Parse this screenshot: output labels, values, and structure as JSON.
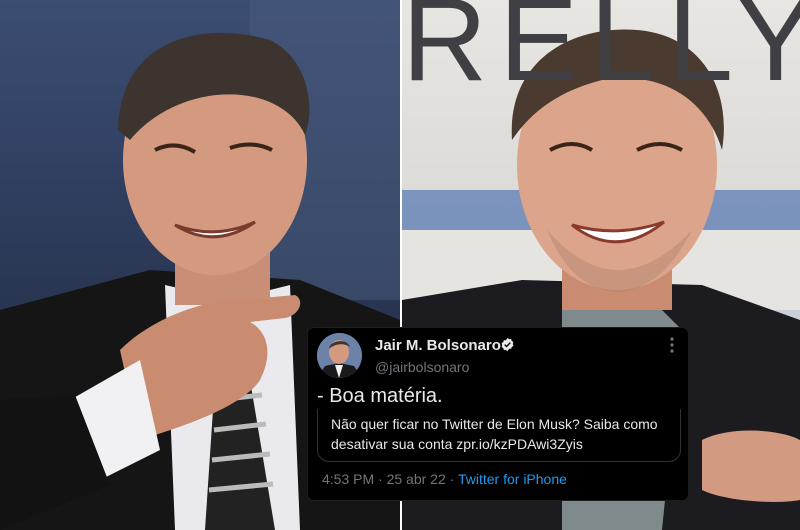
{
  "photos": {
    "left": "photo-left-person-pointing",
    "right": "photo-right-person-smiling",
    "background_lettering": "RELLY"
  },
  "tweet": {
    "author_name": "Jair M. Bolsonaro",
    "author_handle": "@jairbolsonaro",
    "text": "- Boa matéria.",
    "quoted_text": "Não quer ficar no Twitter de Elon Musk? Saiba como desativar sua conta zpr.io/kzPDAwi3Zyis",
    "time": "4:53 PM",
    "separator": "·",
    "date": "25 abr 22",
    "source": "Twitter for iPhone",
    "icons": {
      "verified": "verified-badge-icon",
      "more": "more-options-icon"
    },
    "colors": {
      "background": "#000000",
      "text": "#e7e9ea",
      "muted": "#71767b",
      "link": "#1d9bf0"
    }
  }
}
